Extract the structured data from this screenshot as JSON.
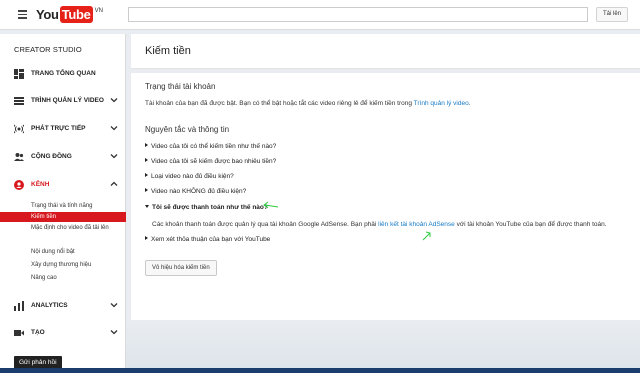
{
  "header": {
    "logo_you": "You",
    "logo_tube": "Tube",
    "logo_country": "VN",
    "search_placeholder": "",
    "upload_label": "Tải lên"
  },
  "sidebar": {
    "title": "CREATOR STUDIO",
    "items": [
      {
        "label": "TRANG TỔNG QUAN",
        "icon": "dashboard-icon",
        "chevron": false
      },
      {
        "label": "TRÌNH QUẢN LÝ VIDEO",
        "icon": "video-manager-icon",
        "chevron": true
      },
      {
        "label": "PHÁT TRỰC TIẾP",
        "icon": "live-icon",
        "chevron": true
      },
      {
        "label": "CỘNG ĐỒNG",
        "icon": "community-icon",
        "chevron": true
      },
      {
        "label": "KÊNH",
        "icon": "channel-icon",
        "chevron": true
      }
    ],
    "channel_subitems": [
      "Trạng thái và tính năng",
      "Kiếm tiền",
      "Mặc định cho video đã tải lên",
      "Nội dung nổi bật",
      "Xây dựng thương hiệu",
      "Nâng cao"
    ],
    "active_subitem": "Kiếm tiền",
    "bottom_items": [
      {
        "label": "ANALYTICS",
        "icon": "analytics-icon",
        "chevron": true
      },
      {
        "label": "TẠO",
        "icon": "create-icon",
        "chevron": true
      }
    ],
    "feedback_label": "Gửi phản hồi"
  },
  "main": {
    "title": "Kiếm tiền",
    "status_heading": "Trạng thái tài khoản",
    "status_text_pre": "Tài khoản của bạn đã được bật. Bạn có thể bật hoặc tắt các video riêng lẻ để kiếm tiền trong ",
    "status_link": "Trình quản lý video",
    "status_text_post": ".",
    "guidelines_heading": "Nguyên tắc và thông tin",
    "faq": [
      "Video của tôi có thể kiếm tiền như thế nào?",
      "Video của tôi sẽ kiếm được bao nhiêu tiền?",
      "Loại video nào đủ điều kiện?",
      "Video nào KHÔNG đủ điều kiện?",
      "Tôi sẽ được thanh toán như thế nào?"
    ],
    "payment_text_pre": "Các khoản thanh toán được quản lý qua tài khoản Google AdSense. Bạn phải ",
    "payment_link": "liên kết tài khoản AdSense",
    "payment_text_post": " với tài khoản YouTube của bạn để được thanh toán.",
    "terms_item": "Xem xét thỏa thuận của bạn với YouTube",
    "disable_button": "Vô hiệu hóa kiếm tiền"
  },
  "colors": {
    "accent": "#e62117",
    "link": "#167ac6",
    "active_bg": "#d7191f",
    "annotation": "#2ecc40"
  }
}
